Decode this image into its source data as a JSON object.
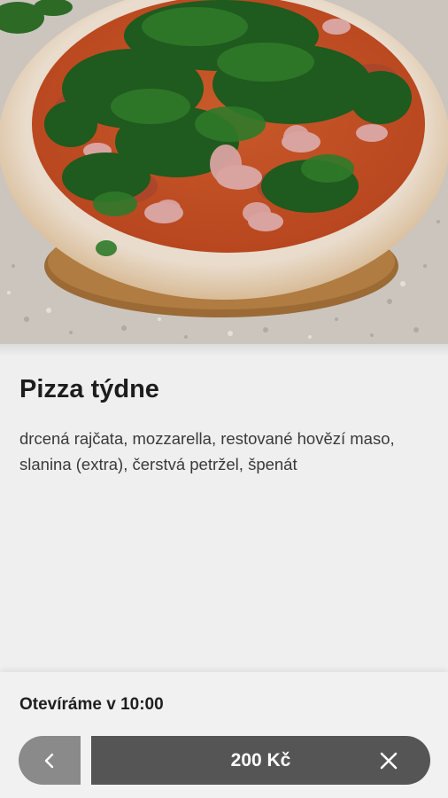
{
  "product": {
    "name": "Pizza týdne",
    "description": "drcená rajčata, mozzarella, restované hovězí maso, slanina (extra), čerstvá petržel, špenát",
    "image_icon": "pizza-photo"
  },
  "status": {
    "opening_text": "Otevíráme v 10:00"
  },
  "cart": {
    "price_label": "200 Kč",
    "back_icon": "chevron-left-icon",
    "close_icon": "close-icon"
  },
  "colors": {
    "background": "#efefef",
    "back_button": "#8a8a8a",
    "price_button": "#555555",
    "text_primary": "#1d1d1d"
  }
}
